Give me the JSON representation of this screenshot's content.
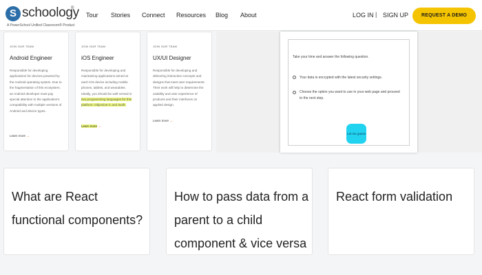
{
  "header": {
    "logo_text": "schoology",
    "logo_mark": "S",
    "logo_tm": "®",
    "logo_subtitle": "A PowerSchool Unified Classroom® Product",
    "nav": [
      "Tour",
      "Stories",
      "Connect",
      "Resources",
      "Blog",
      "About"
    ],
    "login": "LOG IN",
    "separator": "|",
    "signup": "SIGN UP",
    "cta": "REQUEST A DEMO",
    "cta_color": "#f5c400"
  },
  "jobs": [
    {
      "eyebrow": "JOIN OUR TEAM",
      "title": "Android Engineer",
      "desc": "Responsible for developing applications for devices powered by the Android operating system. Due to the fragmentation of this ecosystem, an Android developer must pay special attention to the application's compatibility with multiple versions of Android and device types.",
      "highlight": "",
      "link": "Learn more"
    },
    {
      "eyebrow": "JOIN OUR TEAM",
      "title": "iOS Engineer",
      "desc": "Responsible for developing and maintaining applications aimed at each iOS device including mobile phones, tablets, and wearables. Ideally, you should be well-versed in",
      "highlight": "two programming languages for this platform: Objective-C and Swift.",
      "link": "Learn more"
    },
    {
      "eyebrow": "JOIN OUR TEAM",
      "title": "UX/UI Designer",
      "desc": "Responsible for developing and delivering interactive concepts and designs that meet user requirements. Their work will help to determine the usability and user experience of products and their interfaces on applied design.",
      "highlight": "",
      "link": "Learn more"
    }
  ],
  "preview": {
    "question": "Take your time and answer the following question.",
    "options": [
      "Your data is encrypted with the latest security settings.",
      "Choose the option you want to use in your web page and proceed to the next step."
    ],
    "button": "Let me guess",
    "button_color": "#22d3f0"
  },
  "articles": [
    {
      "title": "What are React functional components?"
    },
    {
      "title": "How to pass data from a parent to a child component & vice versa"
    },
    {
      "title": "React form validation"
    }
  ]
}
